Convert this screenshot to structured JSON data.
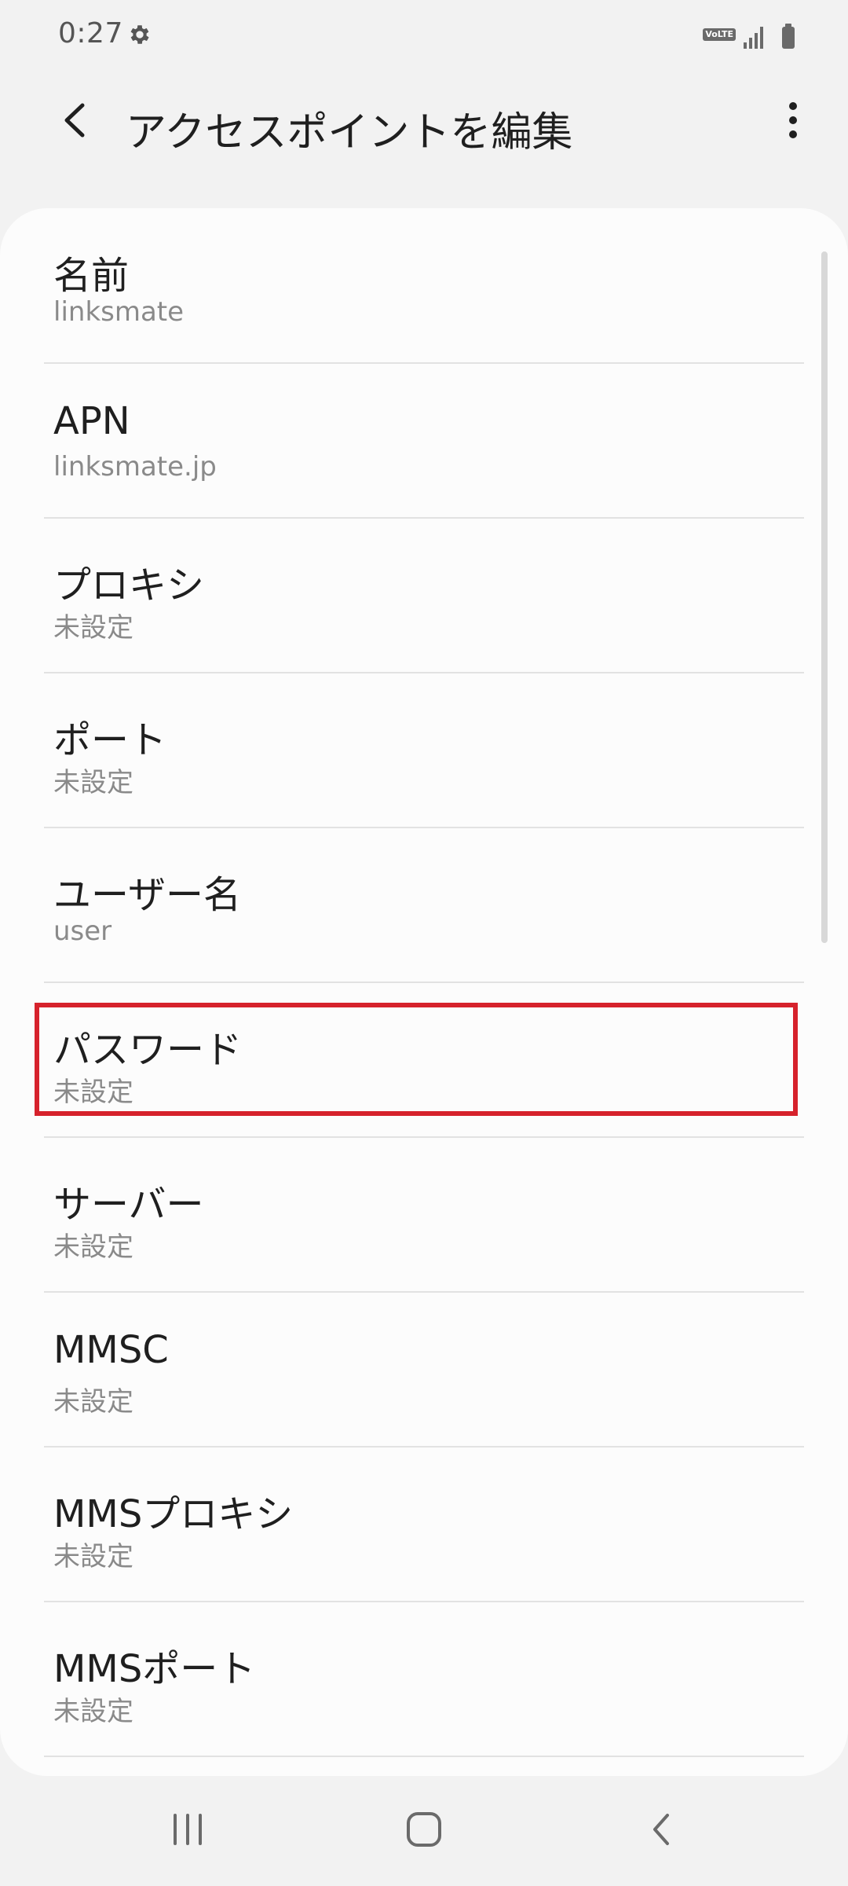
{
  "status_bar": {
    "time": "0:27",
    "volte_label": "VoLTE"
  },
  "app_bar": {
    "title": "アクセスポイントを編集"
  },
  "fields": [
    {
      "title": "名前",
      "value": "linksmate"
    },
    {
      "title": "APN",
      "value": "linksmate.jp"
    },
    {
      "title": "プロキシ",
      "value": "未設定"
    },
    {
      "title": "ポート",
      "value": "未設定"
    },
    {
      "title": "ユーザー名",
      "value": "user"
    },
    {
      "title": "パスワード",
      "value": "未設定"
    },
    {
      "title": "サーバー",
      "value": "未設定"
    },
    {
      "title": "MMSC",
      "value": "未設定"
    },
    {
      "title": "MMSプロキシ",
      "value": "未設定"
    },
    {
      "title": "MMSポート",
      "value": "未設定"
    }
  ],
  "highlighted_field": "パスワード",
  "colors": {
    "background": "#f2f2f2",
    "card": "#fcfcfc",
    "highlight": "#d6222c",
    "secondary_text": "#8a8a8a"
  },
  "icons": {
    "status_settings": "gear-icon",
    "back": "back-arrow-icon",
    "more": "more-vert-icon",
    "nav_recents": "recents-icon",
    "nav_home": "home-icon",
    "nav_back": "nav-back-icon"
  }
}
